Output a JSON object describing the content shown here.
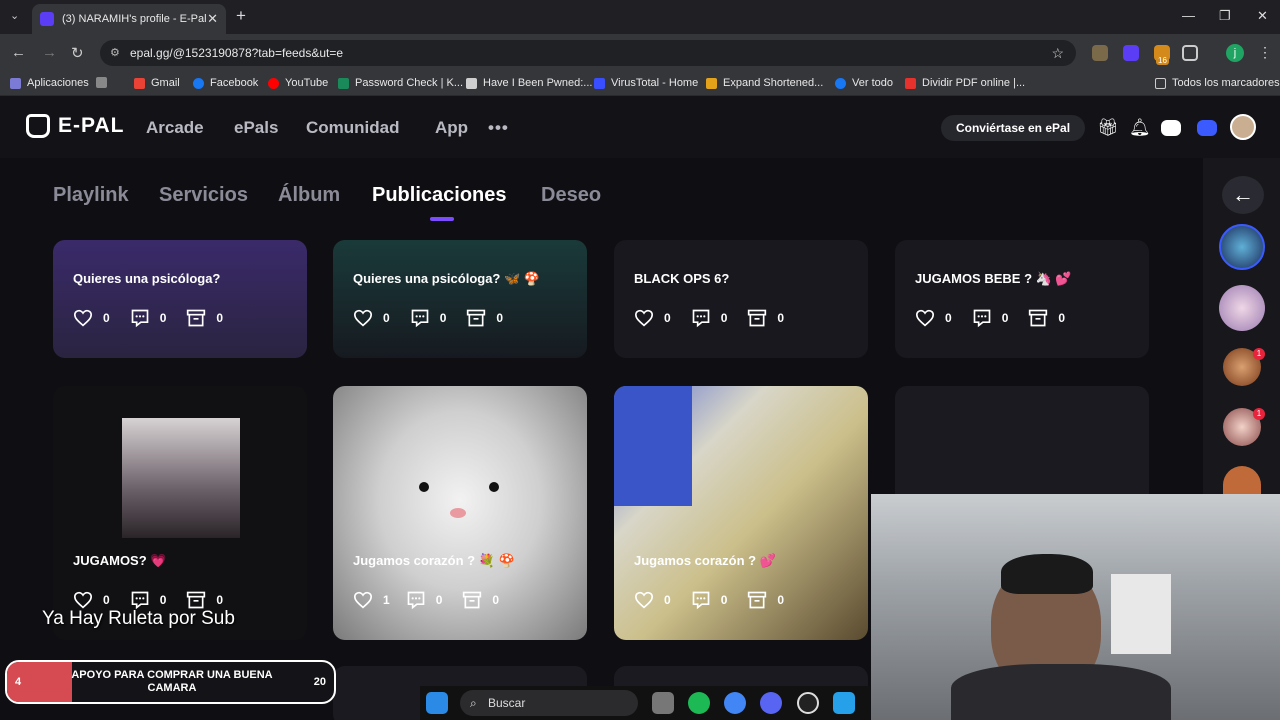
{
  "browser": {
    "tab_title": "(3) NARAMIH's profile - E-Pal",
    "tab_close": "✕",
    "new_tab": "+",
    "url": "epal.gg/@1523190878?tab=feeds&ut=e",
    "bookmarks": [
      {
        "label": "Aplicaciones",
        "color": "#7b7bd6"
      },
      {
        "label": "Gmail",
        "color": "#ea4335"
      },
      {
        "label": "Facebook",
        "color": "#1877f2"
      },
      {
        "label": "YouTube",
        "color": "#ff0000"
      },
      {
        "label": "Password Check | K...",
        "color": "#1b8a5a"
      },
      {
        "label": "Have I Been Pwned:...",
        "color": "#cfcfcf"
      },
      {
        "label": "VirusTotal - Home",
        "color": "#394eff"
      },
      {
        "label": "Expand Shortened...",
        "color": "#e3a21a"
      },
      {
        "label": "Ver todo",
        "color": "#1877f2"
      },
      {
        "label": "Dividir PDF online |...",
        "color": "#e5322d"
      }
    ],
    "all_bookmarks": "Todos los marcadores",
    "extension_badge": "16",
    "profile_initial": "j"
  },
  "header": {
    "logo": "E-PAL",
    "nav": [
      "Arcade",
      "ePals",
      "Comunidad",
      "App"
    ],
    "more": "•••",
    "cta": "Conviértase en ePal"
  },
  "subnav": {
    "tabs": [
      "Playlink",
      "Servicios",
      "Álbum",
      "Publicaciones",
      "Deseo"
    ],
    "active": "Publicaciones"
  },
  "feed": {
    "posts": [
      {
        "title": "Quieres una psicóloga?",
        "likes": "0",
        "comments": "0",
        "saves": "0"
      },
      {
        "title": "Quieres una psicóloga? 🦋 🍄",
        "likes": "0",
        "comments": "0",
        "saves": "0"
      },
      {
        "title": "BLACK OPS 6?",
        "likes": "0",
        "comments": "0",
        "saves": "0"
      },
      {
        "title": "JUGAMOS BEBE ? 🦄 💕",
        "likes": "0",
        "comments": "0",
        "saves": "0"
      },
      {
        "title": "JUGAMOS? 💗",
        "likes": "0",
        "comments": "0",
        "saves": "0"
      },
      {
        "title": "Jugamos corazón ? 💐 🍄",
        "likes": "1",
        "comments": "0",
        "saves": "0"
      },
      {
        "title": "Jugamos corazón ? 💕",
        "likes": "0",
        "comments": "0",
        "saves": "0"
      }
    ]
  },
  "rail": {
    "back_icon": "←",
    "badges": [
      "1",
      "1"
    ]
  },
  "stream": {
    "overlay_text": "Ya Hay Ruleta por Sub",
    "goal_label": "APOYO PARA COMPRAR UNA BUENA CAMARA",
    "goal_current": "4",
    "goal_target": "20"
  },
  "taskbar": {
    "search_placeholder": "Buscar"
  }
}
